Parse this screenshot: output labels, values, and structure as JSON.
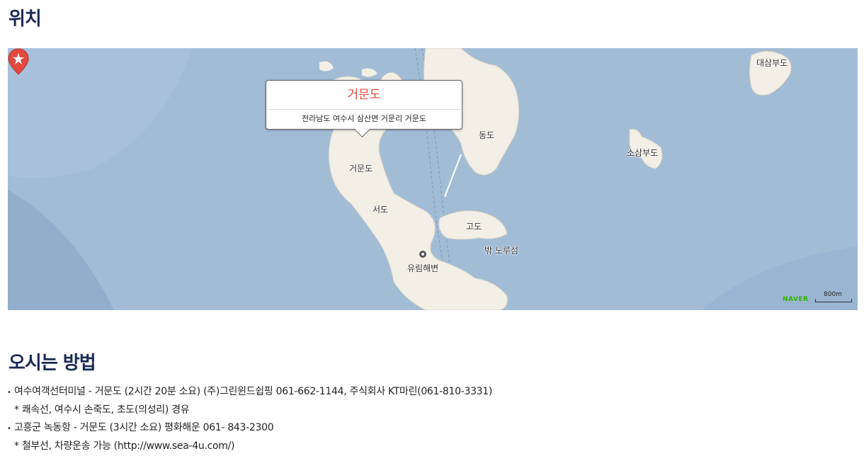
{
  "sections": {
    "location_title": "위치",
    "directions_title": "오시는 방법"
  },
  "map": {
    "popup": {
      "title": "거문도",
      "address": "전라남도 여수시 삼산면 거문리 거문도"
    },
    "labels": {
      "geomundo": "거문도",
      "dongdo": "동도",
      "seodo": "서도",
      "godo": "고도",
      "bakkorusom": "밖 노루섬",
      "yurim_beach": "유림해변",
      "daesambudo": "대삼부도",
      "sosambudo": "소삼부도"
    },
    "brand": "NAVER",
    "scale": "800m",
    "colors": {
      "sea": "#a3bcd6",
      "land": "#f2efe6",
      "marker": "#e24a3f"
    }
  },
  "directions": [
    {
      "main": "여수여객선터미널 - 거문도 (2시간 20분 소요) (주)그린윈드쉽핑 061-662-1144, 주식회사 KT마린(061-810-3331)",
      "note": "* 쾌속선, 여수시 손죽도, 초도(의성리) 경유"
    },
    {
      "main": "고흥군 녹동항 - 거문도 (3시간 소요) 평화해운 061- 843-2300",
      "note": "* 철부선, 차량운송 가능 (http://www.sea-4u.com/)"
    }
  ]
}
